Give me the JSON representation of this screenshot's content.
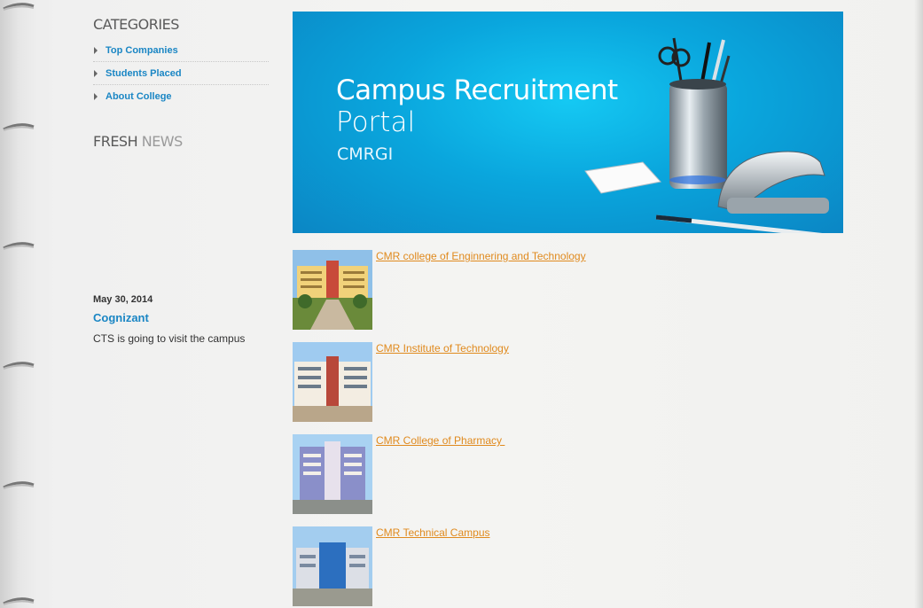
{
  "sidebar": {
    "categories_title": "CATEGORIES",
    "categories": [
      {
        "label": "Top Companies"
      },
      {
        "label": "Students Placed"
      },
      {
        "label": "About College"
      }
    ],
    "fresh_word": "FRESH",
    "news_word": "NEWS"
  },
  "news": {
    "date": "May 30, 2014",
    "title": "Cognizant",
    "body": "CTS is going to visit the campus"
  },
  "banner": {
    "title": "Campus Recruitment",
    "subtitle": "Portal",
    "org": "CMRGI"
  },
  "colleges": [
    {
      "name": "CMR college of Enginnering and Technology"
    },
    {
      "name": "CMR Institute of Technology"
    },
    {
      "name": "CMR College of Pharmacy "
    },
    {
      "name": "CMR Technical Campus"
    }
  ],
  "colors": {
    "link_blue": "#1a86c4",
    "link_orange": "#e08a1e",
    "banner_blue": "#0aa6dd"
  }
}
